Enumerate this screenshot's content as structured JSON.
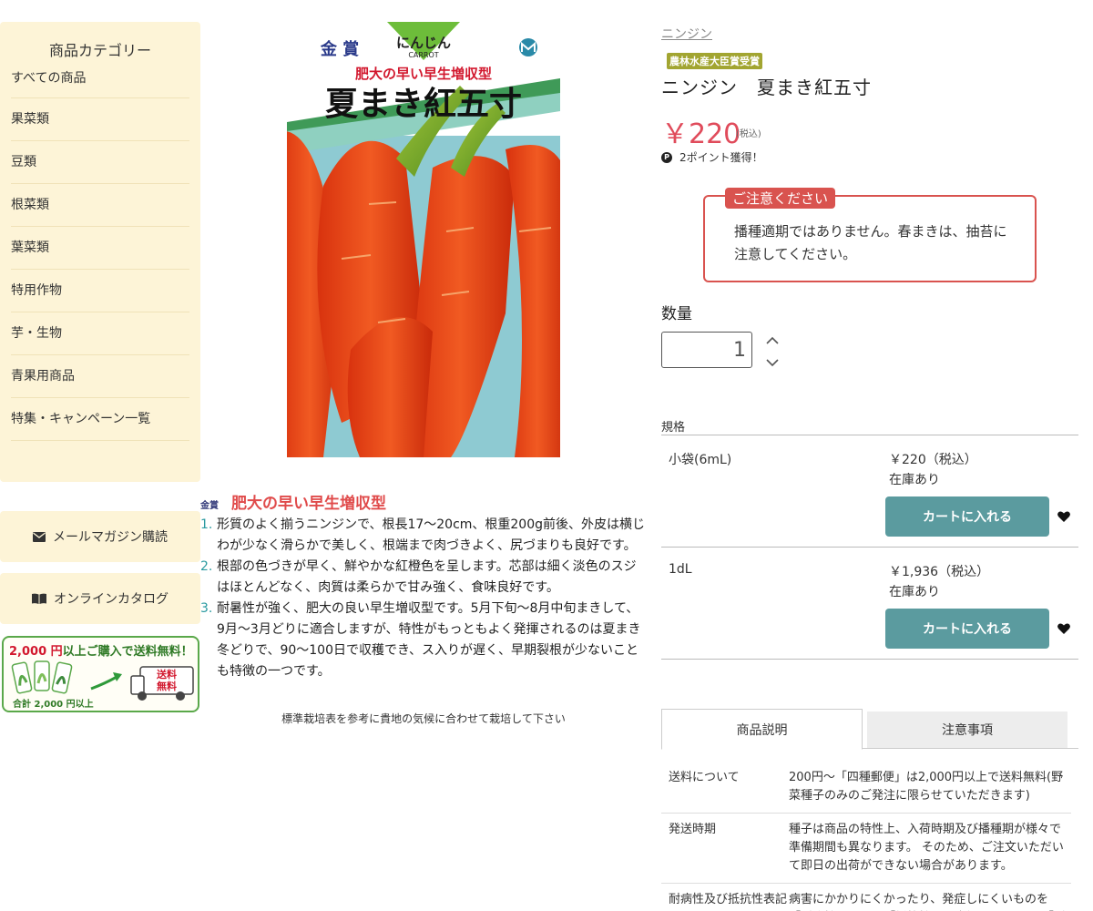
{
  "sidebar": {
    "title": "商品カテゴリー",
    "items": [
      "すべての商品",
      "果菜類",
      "豆類",
      "根菜類",
      "葉菜類",
      "特用作物",
      "芋・生物",
      "青果用商品",
      "特集・キャンペーン一覧"
    ],
    "mail_label": "メールマガジン購読",
    "catalog_label": "オンラインカタログ",
    "banner": {
      "amount": "2,000 円",
      "text": "以上ご購入で送料無料！",
      "truck_label_1": "送料",
      "truck_label_2": "無料",
      "bottom": "合計 2,000 円以上"
    }
  },
  "package": {
    "award": "金 賞",
    "kind": "にんじん",
    "kind_en": "CARROT",
    "tagline": "肥大の早い早生増収型",
    "name": "夏まき紅五寸"
  },
  "features": {
    "badge": "金賞",
    "title": "肥大の早い早生増収型",
    "items": [
      "形質のよく揃うニンジンで、根長17〜20cm、根重200g前後、外皮は横じわが少なく滑らかで美しく、根端まで肉づきよく、尻づまりも良好です。",
      "根部の色づきが早く、鮮やかな紅橙色を呈します。芯部は細く淡色のスジはほとんどなく、肉質は柔らかで甘み強く、食味良好です。",
      "耐暑性が強く、肥大の良い早生増収型です。5月下旬〜8月中旬まきして、9月〜3月どりに適合しますが、特性がもっともよく発揮されるのは夏まき冬どりで、90〜100日で収穫でき、ス入りが遅く、早期裂根が少ないことも特徴の一つです。"
    ],
    "footnote": "標準栽培表を参考に貴地の気候に合わせて栽培して下さい"
  },
  "product": {
    "breadcrumb": "ニンジン",
    "award_badge": "農林水産大臣賞受賞",
    "title": "ニンジン　夏まき紅五寸",
    "price": "￥220",
    "tax_note": "(税込)",
    "points": "2ポイント獲得！",
    "notice_tag": "ご注意ください",
    "notice_text": "播種適期ではありません。春まきは、抽苔に注意してください。",
    "qty_label": "数量",
    "qty_value": "1",
    "spec_label": "規格",
    "cart_label": "カートに入れる",
    "variants": [
      {
        "name": "小袋(6mL)",
        "price": "￥220（税込）",
        "stock": "在庫あり"
      },
      {
        "name": "1dL",
        "price": "￥1,936（税込）",
        "stock": "在庫あり"
      }
    ]
  },
  "tabs": [
    "商品説明",
    "注意事項"
  ],
  "info_rows": [
    {
      "key": "送料について",
      "value": "200円〜「四種郵便」は2,000円以上で送料無料(野菜種子のみのご発注に限らせていただきます)"
    },
    {
      "key": "発送時期",
      "value": "種子は商品の特性上、入荷時期及び播種期が様々で準備期間も異なります。 そのため、ご注文いただいて即日の出荷ができない場合があります。"
    },
    {
      "key": "耐病性及び抵抗性表記について",
      "value": "病害にかかりにくかったり、発症しにくいものを「耐病性」または「抵抗性」と表記しています。「耐病性」"
    }
  ],
  "colors": {
    "sidebar_bg": "#fdf4d7",
    "price": "#e04b5b",
    "cart_button": "#5b9b9f",
    "notice": "#d9534f",
    "accent_teal": "#2a9aa0"
  },
  "icons": {
    "mail": "envelope-icon",
    "catalog": "book-icon",
    "points": "p-icon",
    "fav": "heart-icon",
    "qty_up": "chevron-up-icon",
    "qty_down": "chevron-down-icon"
  }
}
